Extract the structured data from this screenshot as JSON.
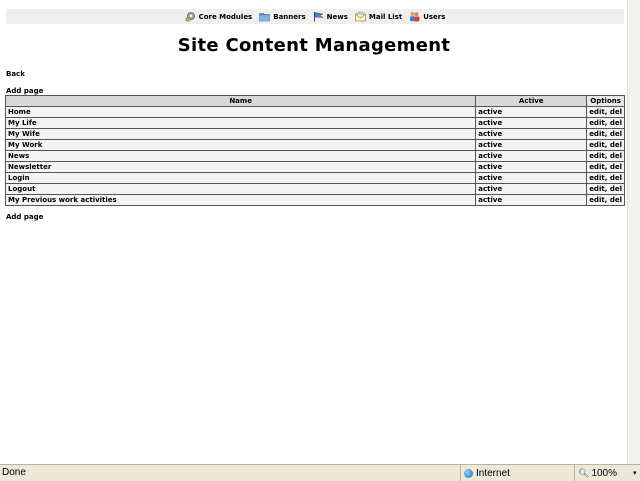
{
  "nav": {
    "items": [
      {
        "label": "Core Modules",
        "icon": "gear-icon"
      },
      {
        "label": "Banners",
        "icon": "folder-icon"
      },
      {
        "label": "News",
        "icon": "news-flag-icon"
      },
      {
        "label": "Mail List",
        "icon": "mail-icon"
      },
      {
        "label": "Users",
        "icon": "users-icon"
      }
    ]
  },
  "page": {
    "title": "Site Content Management",
    "back_label": "Back",
    "add_page_top": "Add page",
    "add_page_bottom": "Add page"
  },
  "table": {
    "headers": [
      "Name",
      "Active",
      "Options"
    ],
    "rows": [
      {
        "name": "Home",
        "active": "active",
        "edit": "edit",
        "del": "del"
      },
      {
        "name": "My Life",
        "active": "active",
        "edit": "edit",
        "del": "del"
      },
      {
        "name": "My Wife",
        "active": "active",
        "edit": "edit",
        "del": "del"
      },
      {
        "name": "My Work",
        "active": "active",
        "edit": "edit",
        "del": "del"
      },
      {
        "name": "News",
        "active": "active",
        "edit": "edit",
        "del": "del"
      },
      {
        "name": "Newsletter",
        "active": "active",
        "edit": "edit",
        "del": "del"
      },
      {
        "name": "Login",
        "active": "active",
        "edit": "edit",
        "del": "del"
      },
      {
        "name": "Logout",
        "active": "active",
        "edit": "edit",
        "del": "del"
      },
      {
        "name": "My Previous work activities",
        "active": "active",
        "edit": "edit",
        "del": "del"
      }
    ]
  },
  "statusbar": {
    "status": "Done",
    "zone": "Internet",
    "zoom": "100%"
  }
}
